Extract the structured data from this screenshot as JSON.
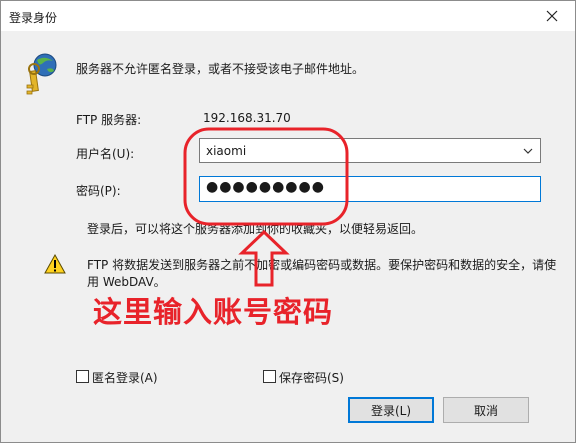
{
  "window": {
    "title": "登录身份"
  },
  "message": {
    "text": "服务器不允许匿名登录，或者不接受该电子邮件地址。"
  },
  "ftp_server": {
    "label": "FTP 服务器:",
    "value": "192.168.31.70"
  },
  "username": {
    "label": "用户名(U):",
    "value": "xiaomi"
  },
  "password": {
    "label": "密码(P):",
    "masked": "●●●●●●●●●"
  },
  "hint": {
    "text": "登录后，可以将这个服务器添加到你的收藏夹，以便轻易返回。"
  },
  "warning": {
    "line1": "FTP 将数据发送到服务器之前不加密或编码密码或数据。要保护密码和数据的安全，请使",
    "line2": "用 WebDAV。"
  },
  "checkboxes": {
    "anonymous": {
      "label": "匿名登录(A)",
      "checked": false
    },
    "save_password": {
      "label": "保存密码(S)",
      "checked": false
    }
  },
  "buttons": {
    "login": "登录(L)",
    "cancel": "取消"
  },
  "annotation": {
    "text": "这里输入账号密码",
    "color": "#e8232a"
  },
  "icons": {
    "key": "key-icon",
    "warning": "warning-icon",
    "close": "close-icon"
  }
}
